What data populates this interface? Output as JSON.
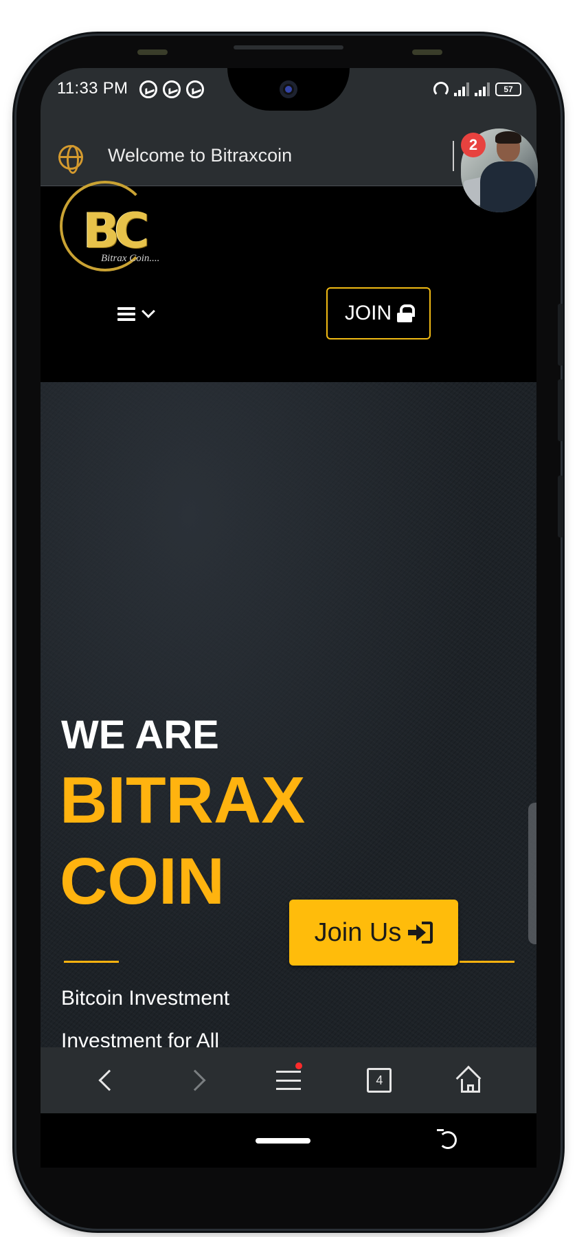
{
  "status_bar": {
    "time": "11:33 PM",
    "battery": "57",
    "left_icons": [
      "messenger-icon",
      "podcast-icon",
      "messenger-icon"
    ],
    "right_icons": [
      "hotspot-icon",
      "signal-icon",
      "signal-icon",
      "battery-icon"
    ]
  },
  "browser": {
    "page_title": "Welcome to Bitraxcoin",
    "favicon": "globe-icon",
    "tabs_count": "4"
  },
  "chat_head": {
    "badge_count": "2"
  },
  "site_header": {
    "logo_letters": "BC",
    "logo_subtitle": "Bitrax Coin....",
    "join_label": "JOIN"
  },
  "hero": {
    "line1": "WE ARE",
    "line2": "BITRAX",
    "line3": "COIN",
    "cta_label": "Join Us",
    "tagline": "Bitcoin Investment",
    "tagline_2": "Investment for All"
  },
  "colors": {
    "accent": "#ffb30f",
    "button_yellow": "#ffbc0b",
    "bar_bg": "#2a2e31",
    "badge_red": "#e8423f"
  }
}
